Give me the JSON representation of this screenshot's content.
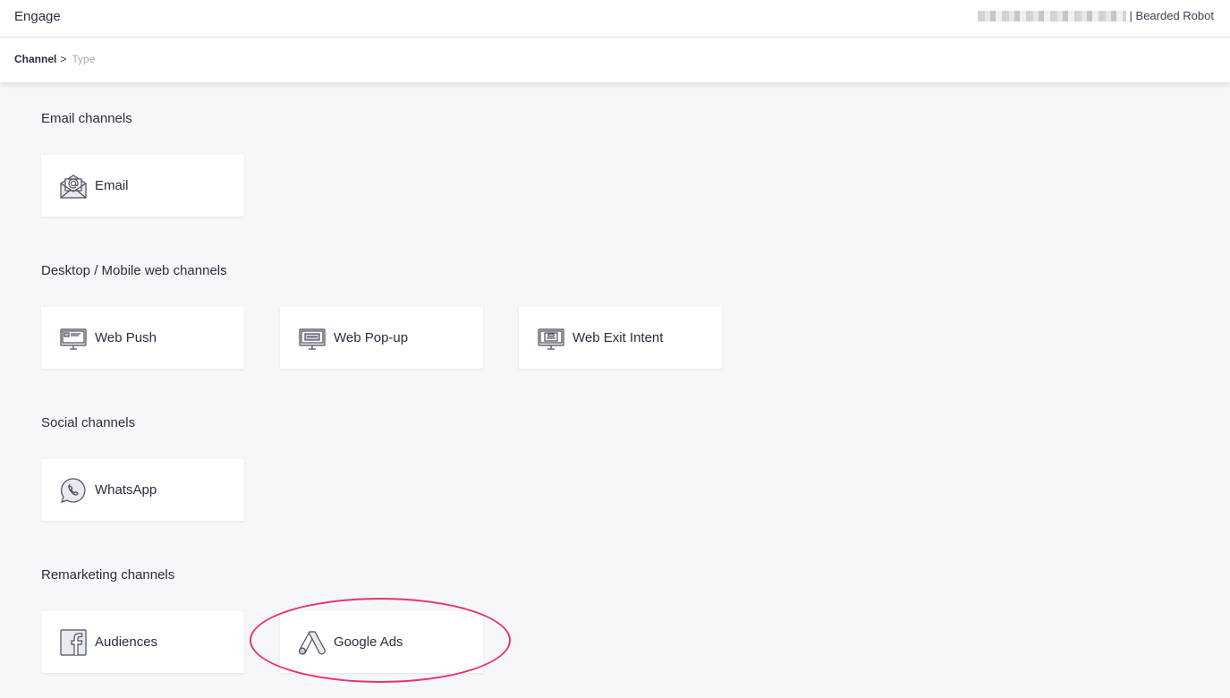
{
  "header": {
    "app_title": "Engage",
    "account_name": "| Bearded Robot"
  },
  "breadcrumb": {
    "active": "Channel",
    "separator": ">",
    "inactive": "Type"
  },
  "sections": [
    {
      "title": "Email channels",
      "cards": [
        {
          "label": "Email",
          "icon": "email-envelope-icon"
        }
      ]
    },
    {
      "title": "Desktop / Mobile web channels",
      "cards": [
        {
          "label": "Web Push",
          "icon": "monitor-push-icon"
        },
        {
          "label": "Web Pop-up",
          "icon": "monitor-popup-icon"
        },
        {
          "label": "Web Exit Intent",
          "icon": "monitor-exit-icon"
        }
      ]
    },
    {
      "title": "Social channels",
      "cards": [
        {
          "label": "WhatsApp",
          "icon": "whatsapp-icon"
        }
      ]
    },
    {
      "title": "Remarketing channels",
      "cards": [
        {
          "label": "Audiences",
          "icon": "facebook-icon"
        },
        {
          "label": "Google Ads",
          "icon": "google-ads-icon"
        }
      ]
    }
  ],
  "colors": {
    "highlight": "#e8326e",
    "text": "#2b2d3f",
    "background": "#f6f7f9"
  }
}
